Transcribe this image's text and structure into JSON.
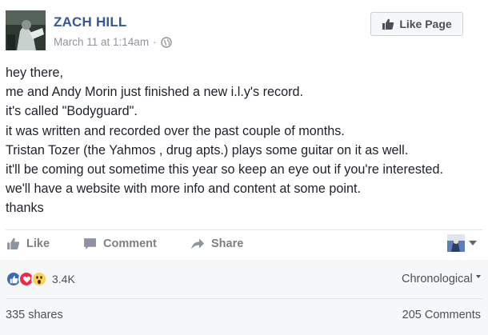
{
  "post": {
    "author": "ZACH HILL",
    "date": "March 11 at 1:14am",
    "separator": "·",
    "audience_icon": "globe-icon",
    "like_page_label": "Like Page",
    "body_lines": [
      "hey there,",
      "me and Andy Morin just finished a new i.l.y's record.",
      "it's called \"Bodyguard\".",
      "it was written and recorded over the past couple of months.",
      "Tristan Tozer (the Yahmos , drug apts.) plays some guitar on it as well.",
      "it'll be coming out sometime this year so keep an eye out if you're interested.",
      "we'll have a website with more info and content at some point.",
      "thanks"
    ]
  },
  "actions": {
    "like": "Like",
    "comment": "Comment",
    "share": "Share"
  },
  "stats": {
    "reaction_icons": [
      "like-reaction-icon",
      "love-reaction-icon",
      "wow-reaction-icon"
    ],
    "reaction_count": "3.4K",
    "order_label": "Chronological",
    "shares": "335 shares",
    "comments": "205 Comments"
  },
  "colors": {
    "author_link": "#365899",
    "like_reaction": "#4267b2",
    "love_reaction": "#f0284a",
    "wow_reaction": "#fcd053",
    "muted_text": "#90949c"
  }
}
